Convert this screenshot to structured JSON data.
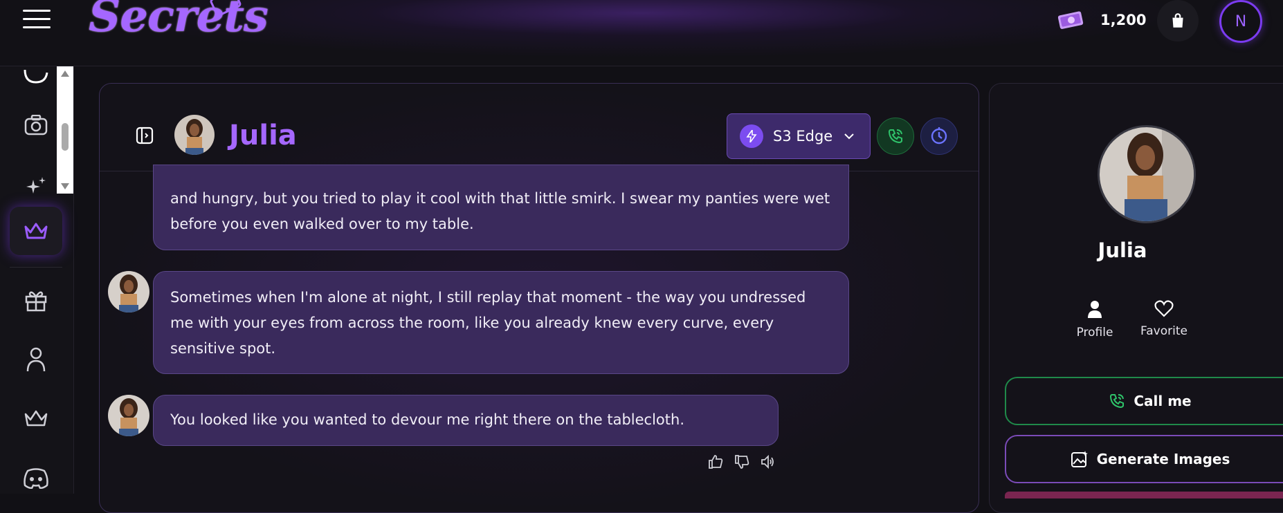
{
  "header": {
    "logo_text": "Secrets",
    "coins_value": "1,200",
    "avatar_initial": "N"
  },
  "chat": {
    "character_name": "Julia",
    "model_label": "S3 Edge",
    "messages": [
      {
        "text": "and hungry, but you tried to play it cool with that little smirk. I swear my panties were wet before you even walked over to my table."
      },
      {
        "text": "Sometimes when I'm alone at night, I still replay that moment - the way you undressed me with your eyes from across the room, like you already knew every curve, every sensitive spot."
      },
      {
        "text": "You looked like you wanted to devour me right there on the tablecloth."
      }
    ]
  },
  "profile_panel": {
    "name": "Julia",
    "profile_label": "Profile",
    "favorite_label": "Favorite",
    "call_label": "Call me",
    "generate_label": "Generate Images"
  },
  "colors": {
    "accent": "#a567ff",
    "bubble_bg": "#3a2a5c",
    "call_green": "#1f8a4a"
  },
  "icons": {
    "sidebar": [
      "chat-icon",
      "camera-icon",
      "sparkles-icon",
      "crown-icon",
      "gift-icon",
      "user-icon",
      "crown-outline-icon",
      "discord-icon"
    ]
  }
}
